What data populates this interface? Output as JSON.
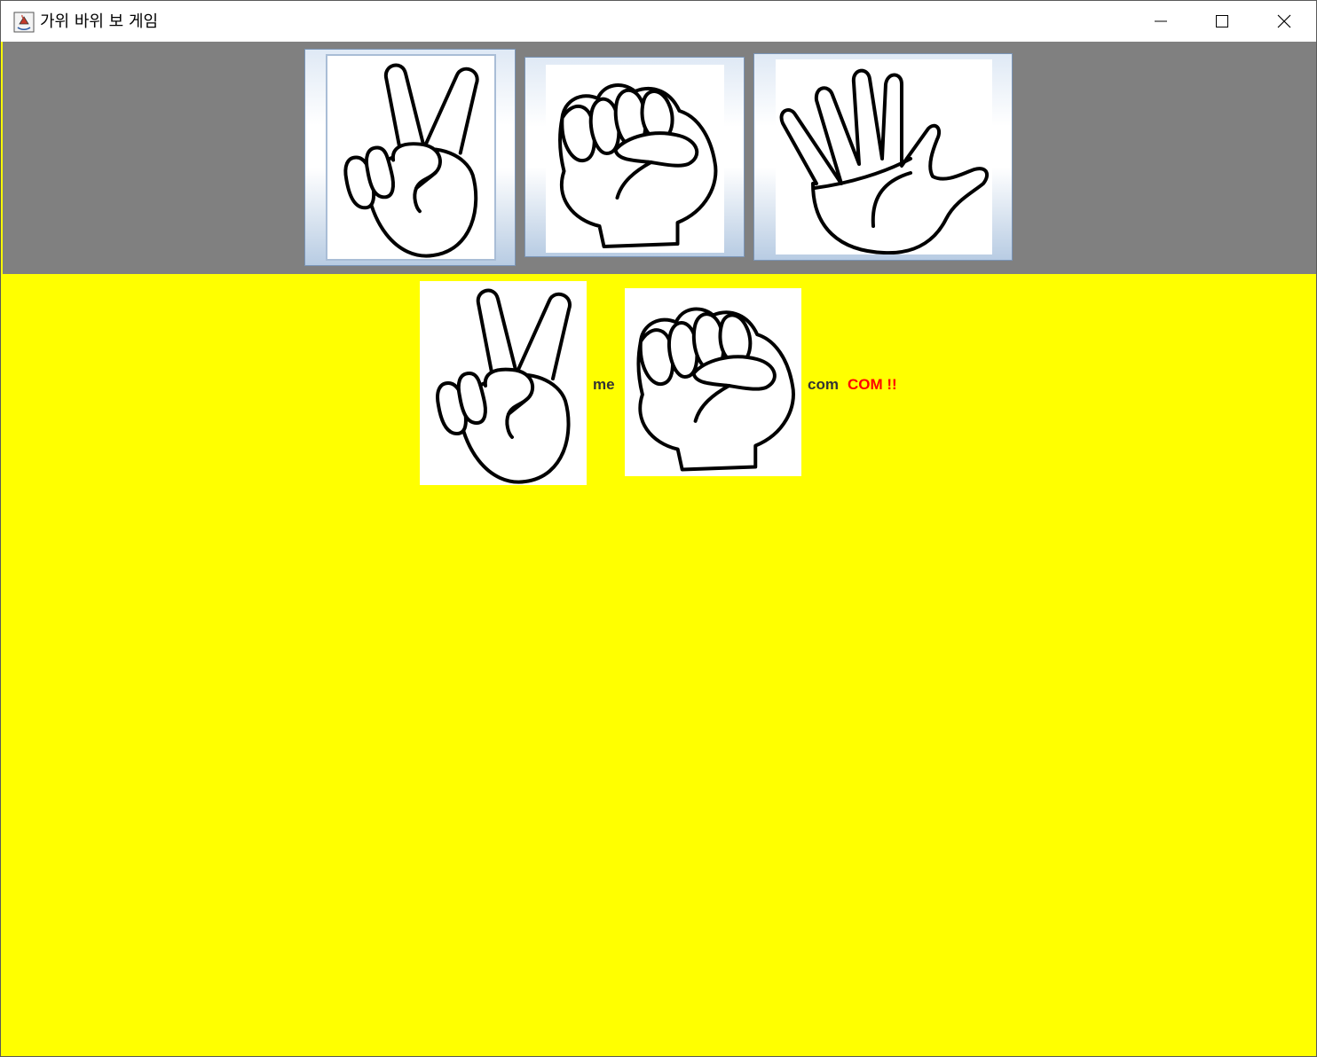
{
  "window": {
    "title": "가위 바위 보 게임",
    "icon": "java-coffee-icon",
    "controls": [
      "minimize-icon",
      "maximize-icon",
      "close-icon"
    ]
  },
  "choices": [
    {
      "id": "scissors",
      "icon": "scissors-hand-icon",
      "selected": true
    },
    {
      "id": "rock",
      "icon": "rock-fist-icon",
      "selected": false
    },
    {
      "id": "paper",
      "icon": "paper-hand-icon",
      "selected": false
    }
  ],
  "result": {
    "me_choice_icon": "scissors-hand-icon",
    "me_label": "me",
    "com_choice_icon": "rock-fist-icon",
    "com_label": "com",
    "outcome": "COM !!"
  },
  "colors": {
    "top_panel": "#808080",
    "result_background": "#ffff00",
    "label_text": "#333333",
    "outcome_text": "#ff0000"
  }
}
